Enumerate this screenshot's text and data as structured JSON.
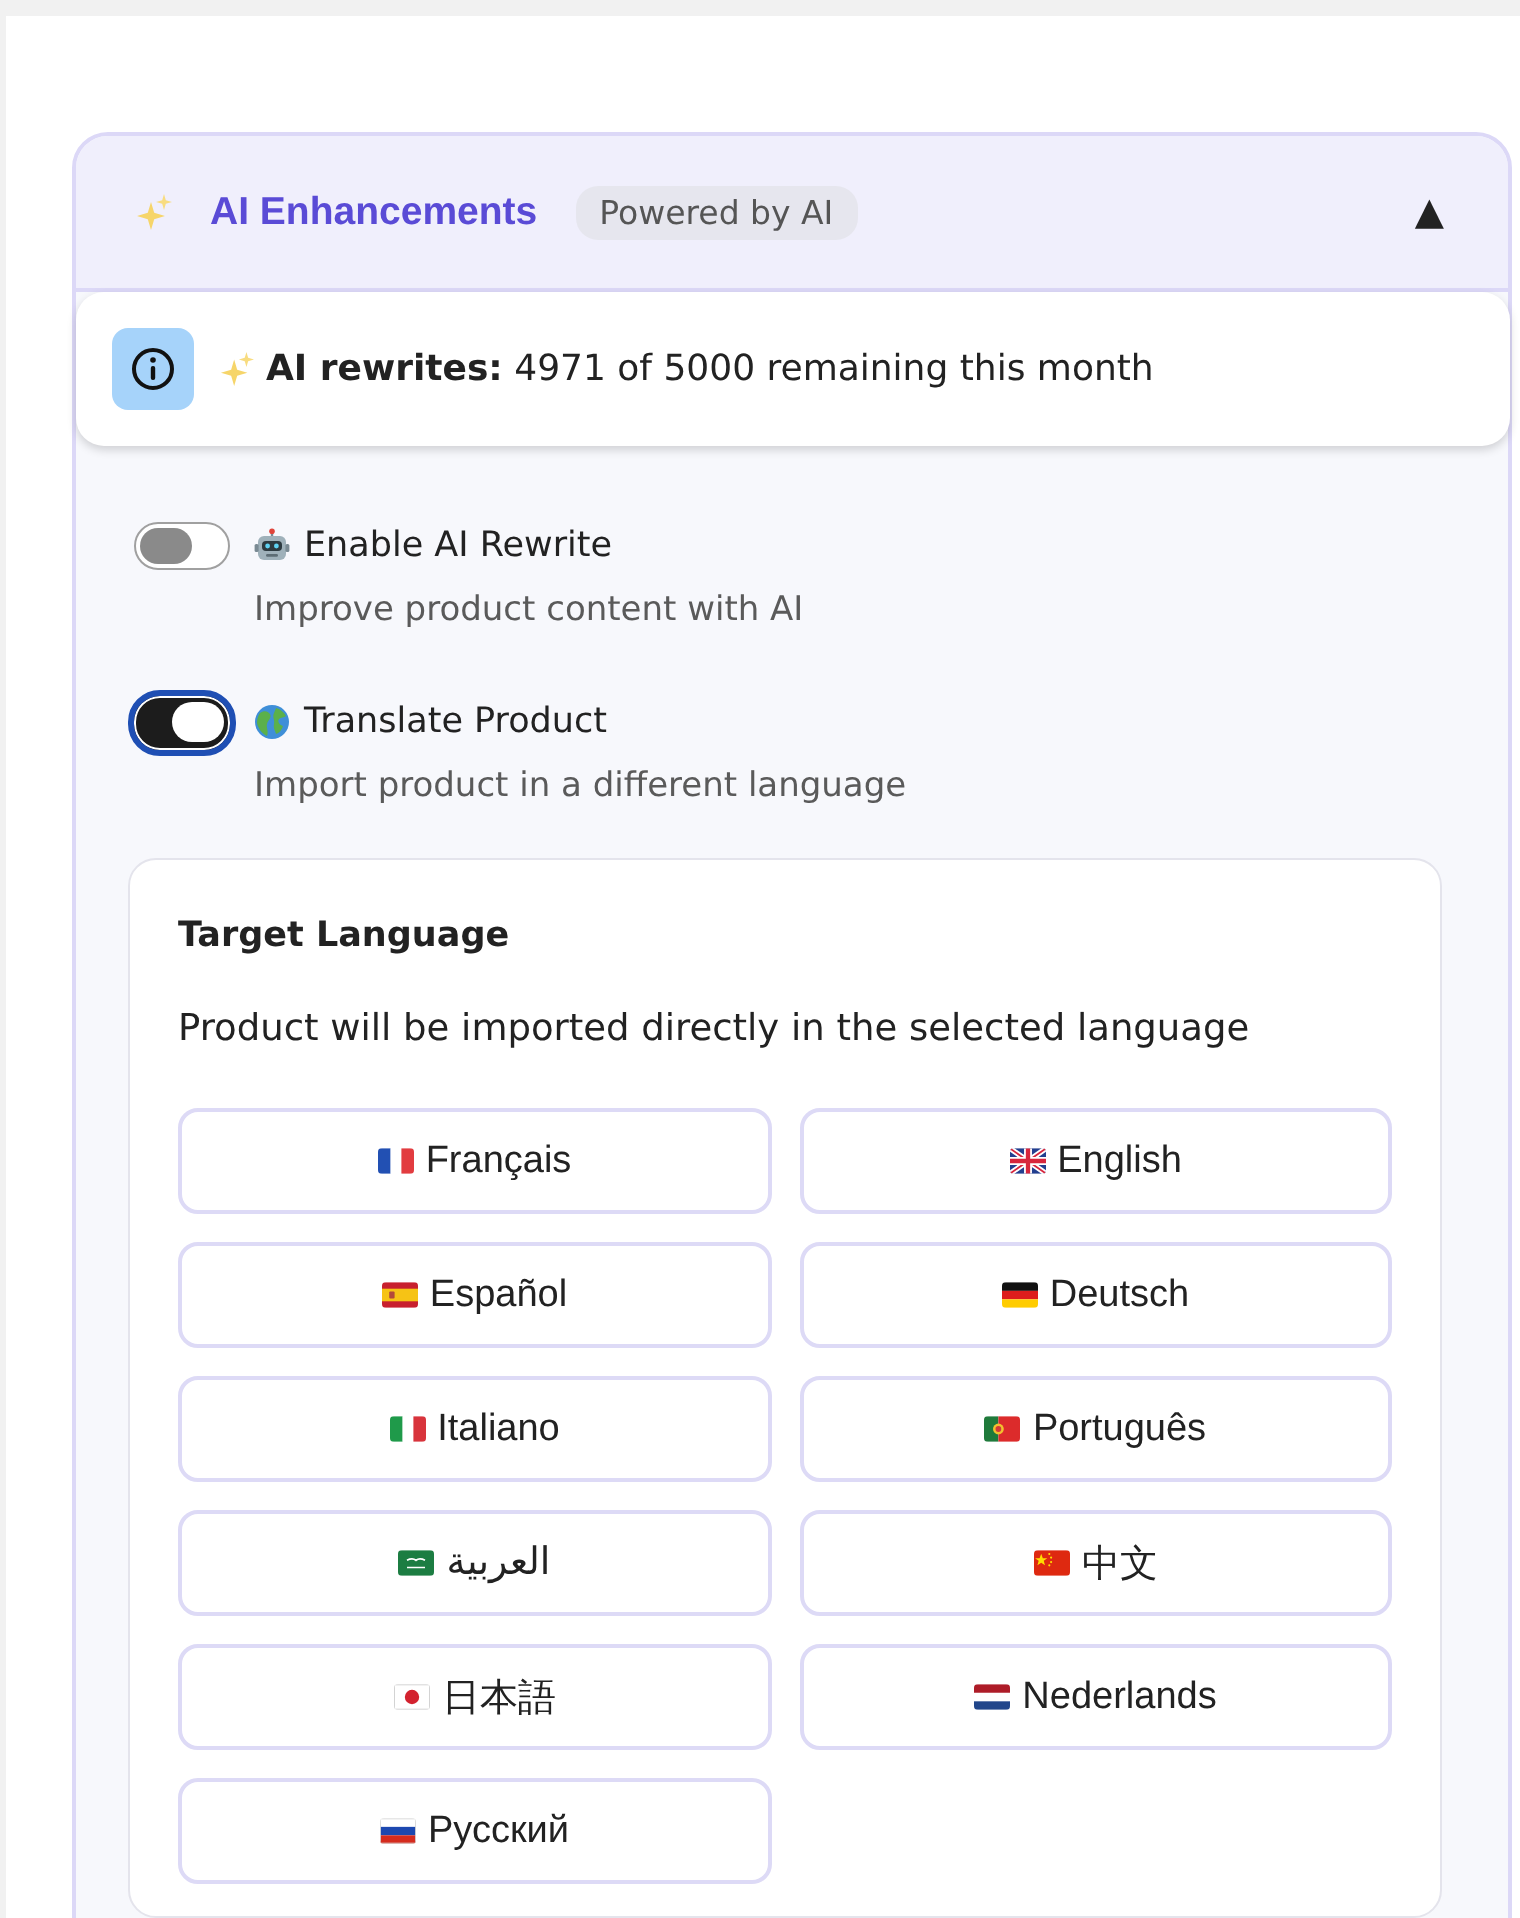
{
  "panel": {
    "title": "AI Enhancements",
    "badge": "Powered by AI",
    "collapse_glyph": "▲",
    "expanded": true
  },
  "quota_notice": {
    "text": "**AI rewrites:** 4971 of 5000 remaining this month"
  },
  "options": [
    {
      "label": "Enable AI Rewrite",
      "description": "Improve product content with AI",
      "on": false,
      "focused": false
    },
    {
      "label": "Translate Product",
      "description": "Import product in a different language",
      "on": true,
      "focused": true
    }
  ],
  "target_language": {
    "title": "Target Language",
    "description": "Product will be imported directly in the selected language",
    "languages": [
      {
        "label": "Français",
        "selected": false
      },
      {
        "label": "English",
        "selected": false
      },
      {
        "label": "Español",
        "selected": false
      },
      {
        "label": "Deutsch",
        "selected": false
      },
      {
        "label": "Italiano",
        "selected": false
      },
      {
        "label": "Português",
        "selected": false
      },
      {
        "label": "العربية",
        "selected": false
      },
      {
        "label": "中文",
        "selected": false
      },
      {
        "label": "日本語",
        "selected": false
      },
      {
        "label": "Nederlands",
        "selected": false
      },
      {
        "label": "Русский",
        "selected": false
      }
    ]
  }
}
